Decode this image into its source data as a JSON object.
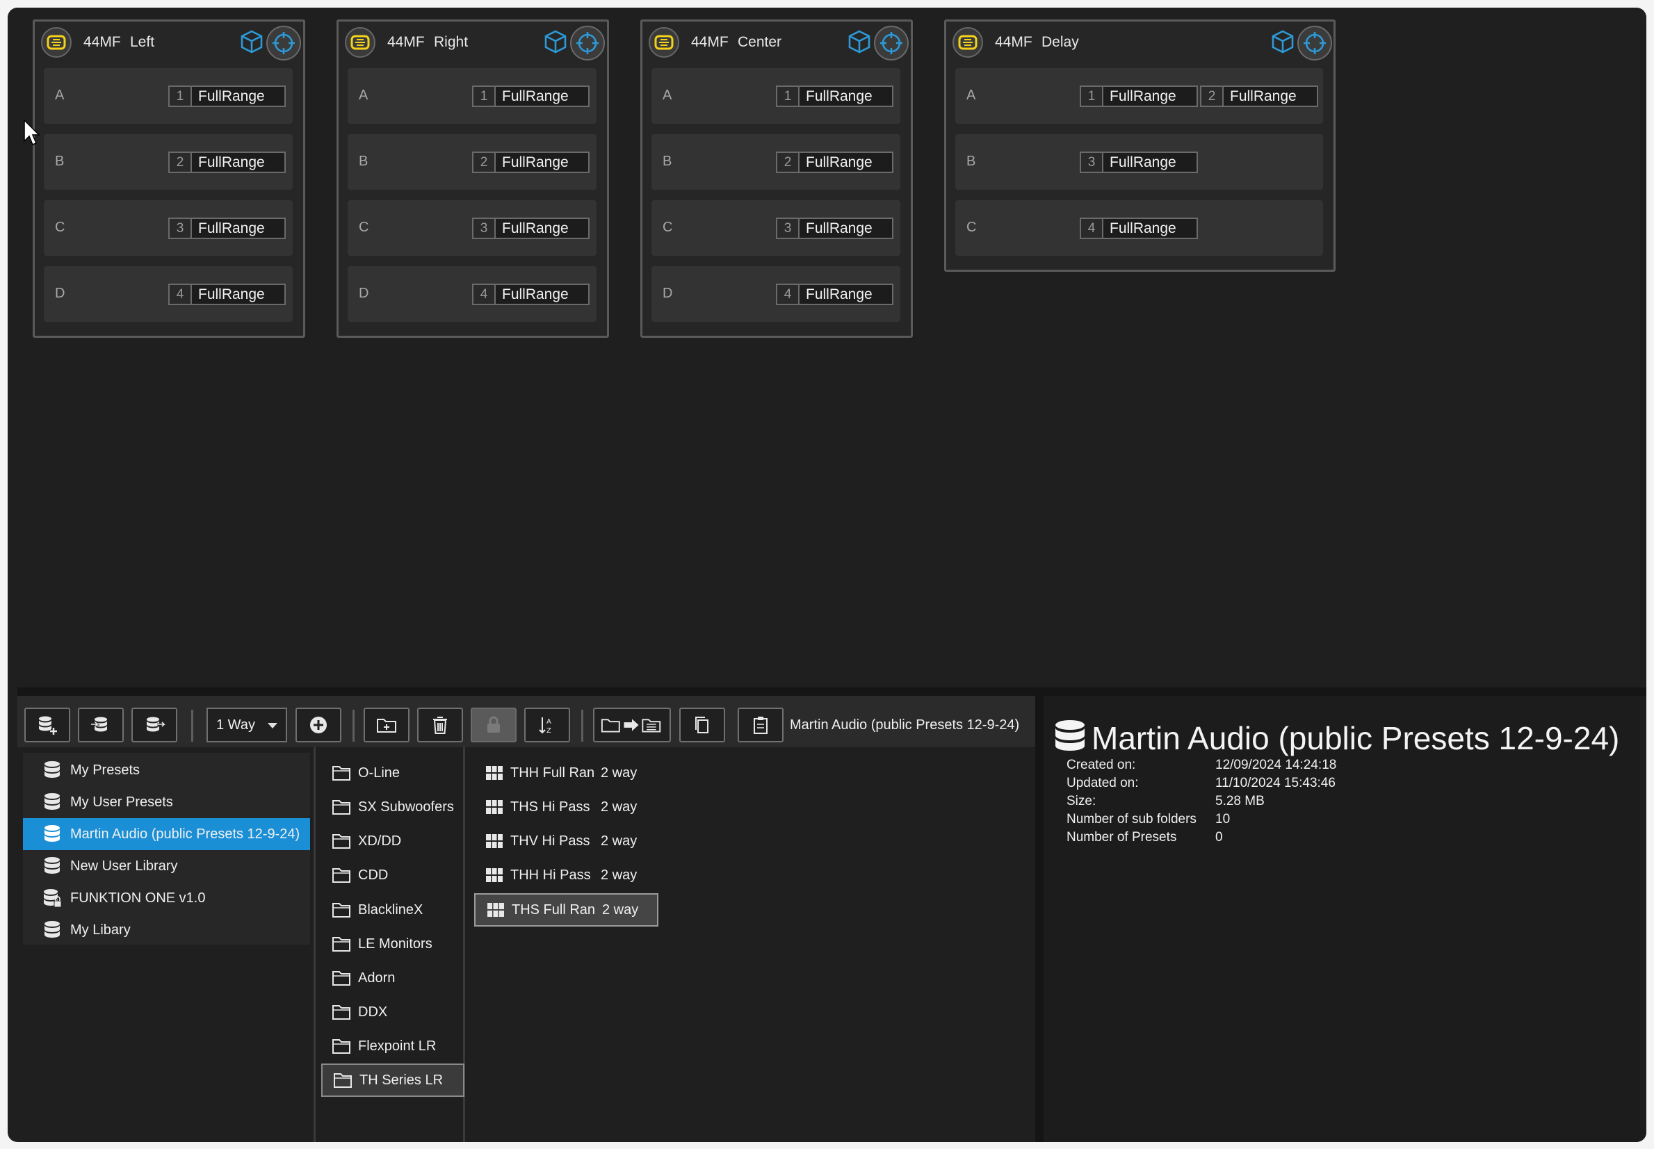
{
  "amps": [
    {
      "model": "44MF",
      "name": "Left",
      "channels": [
        {
          "letter": "A",
          "outputs": [
            {
              "num": "1",
              "label": "FullRange"
            }
          ]
        },
        {
          "letter": "B",
          "outputs": [
            {
              "num": "2",
              "label": "FullRange"
            }
          ]
        },
        {
          "letter": "C",
          "outputs": [
            {
              "num": "3",
              "label": "FullRange"
            }
          ]
        },
        {
          "letter": "D",
          "outputs": [
            {
              "num": "4",
              "label": "FullRange"
            }
          ]
        }
      ]
    },
    {
      "model": "44MF",
      "name": "Right",
      "channels": [
        {
          "letter": "A",
          "outputs": [
            {
              "num": "1",
              "label": "FullRange"
            }
          ]
        },
        {
          "letter": "B",
          "outputs": [
            {
              "num": "2",
              "label": "FullRange"
            }
          ]
        },
        {
          "letter": "C",
          "outputs": [
            {
              "num": "3",
              "label": "FullRange"
            }
          ]
        },
        {
          "letter": "D",
          "outputs": [
            {
              "num": "4",
              "label": "FullRange"
            }
          ]
        }
      ]
    },
    {
      "model": "44MF",
      "name": "Center",
      "channels": [
        {
          "letter": "A",
          "outputs": [
            {
              "num": "1",
              "label": "FullRange"
            }
          ]
        },
        {
          "letter": "B",
          "outputs": [
            {
              "num": "2",
              "label": "FullRange"
            }
          ]
        },
        {
          "letter": "C",
          "outputs": [
            {
              "num": "3",
              "label": "FullRange"
            }
          ]
        },
        {
          "letter": "D",
          "outputs": [
            {
              "num": "4",
              "label": "FullRange"
            }
          ]
        }
      ]
    },
    {
      "model": "44MF",
      "name": "Delay",
      "channels": [
        {
          "letter": "A",
          "outputs": [
            {
              "num": "1",
              "label": "FullRange"
            },
            {
              "num": "2",
              "label": "FullRange"
            }
          ]
        },
        {
          "letter": "B",
          "outputs": [
            {
              "num": "3",
              "label": "FullRange"
            }
          ]
        },
        {
          "letter": "C",
          "outputs": [
            {
              "num": "4",
              "label": "FullRange"
            }
          ]
        }
      ]
    }
  ],
  "toolbar": {
    "way_select": "1 Way",
    "path": "Martin Audio (public Presets 12-9-24)"
  },
  "libraries": [
    {
      "label": "My Presets",
      "icon": "database-icon",
      "selected": false
    },
    {
      "label": "My User Presets",
      "icon": "database-icon",
      "selected": false
    },
    {
      "label": "Martin Audio (public Presets 12-9-24)",
      "icon": "database-icon",
      "selected": true
    },
    {
      "label": "New User Library",
      "icon": "database-icon",
      "selected": false
    },
    {
      "label": "FUNKTION ONE v1.0",
      "icon": "locked-database-icon",
      "selected": false
    },
    {
      "label": "My Libary",
      "icon": "database-icon",
      "selected": false
    }
  ],
  "folders": [
    {
      "label": "O-Line",
      "selected": false
    },
    {
      "label": "SX Subwoofers",
      "selected": false
    },
    {
      "label": "XD/DD",
      "selected": false
    },
    {
      "label": "CDD",
      "selected": false
    },
    {
      "label": "BlacklineX",
      "selected": false
    },
    {
      "label": "LE Monitors",
      "selected": false
    },
    {
      "label": "Adorn",
      "selected": false
    },
    {
      "label": "DDX",
      "selected": false
    },
    {
      "label": "Flexpoint LR",
      "selected": false
    },
    {
      "label": "TH Series LR",
      "selected": true
    }
  ],
  "presets": [
    {
      "name": "THH Full Ran",
      "ways": "2 way",
      "selected": false
    },
    {
      "name": "THS Hi Pass",
      "ways": "2 way",
      "selected": false
    },
    {
      "name": "THV Hi Pass",
      "ways": "2 way",
      "selected": false
    },
    {
      "name": "THH Hi Pass",
      "ways": "2 way",
      "selected": false
    },
    {
      "name": "THS Full Ran",
      "ways": "2 way",
      "selected": true
    }
  ],
  "info": {
    "title": "Martin Audio (public Presets 12-9-24)",
    "rows": [
      {
        "label": "Created on:",
        "value": "12/09/2024 14:24:18"
      },
      {
        "label": "Updated on:",
        "value": "11/10/2024 15:43:46"
      },
      {
        "label": "Size:",
        "value": "5.28 MB"
      },
      {
        "label": "Number of sub folders",
        "value": "10"
      },
      {
        "label": "Number of Presets",
        "value": "0"
      }
    ]
  },
  "colors": {
    "accent": "#1a8fd6",
    "logo": "#f2d21b",
    "icon_blue": "#2d9ad8"
  }
}
